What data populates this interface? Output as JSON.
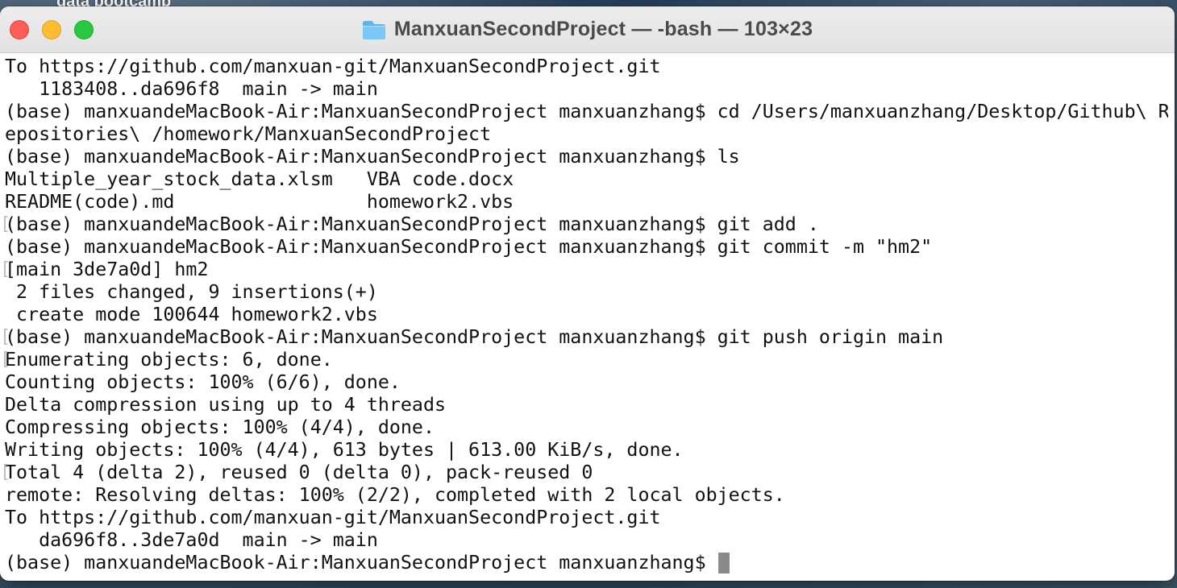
{
  "desktop": {
    "folder_label": "data bootcamp"
  },
  "window": {
    "title": "ManxuanSecondProject — -bash — 103×23",
    "title_icon": "folder-icon"
  },
  "terminal": {
    "lines": [
      {
        "text": "To https://github.com/manxuan-git/ManxuanSecondProject.git",
        "marked": false
      },
      {
        "text": "   1183408..da696f8  main -> main",
        "marked": false
      },
      {
        "text": "(base) manxuandeMacBook-Air:ManxuanSecondProject manxuanzhang$ cd /Users/manxuanzhang/Desktop/Github\\ R",
        "marked": false
      },
      {
        "text": "epositories\\ /homework/ManxuanSecondProject",
        "marked": false
      },
      {
        "text": "(base) manxuandeMacBook-Air:ManxuanSecondProject manxuanzhang$ ls",
        "marked": false
      },
      {
        "text": "Multiple_year_stock_data.xlsm   VBA code.docx",
        "marked": false
      },
      {
        "text": "README(code).md                 homework2.vbs",
        "marked": false
      },
      {
        "text": "(base) manxuandeMacBook-Air:ManxuanSecondProject manxuanzhang$ git add .",
        "marked": true
      },
      {
        "text": "(base) manxuandeMacBook-Air:ManxuanSecondProject manxuanzhang$ git commit -m \"hm2\"",
        "marked": false
      },
      {
        "text": "[main 3de7a0d] hm2",
        "marked": true
      },
      {
        "text": " 2 files changed, 9 insertions(+)",
        "marked": false
      },
      {
        "text": " create mode 100644 homework2.vbs",
        "marked": false
      },
      {
        "text": "(base) manxuandeMacBook-Air:ManxuanSecondProject manxuanzhang$ git push origin main",
        "marked": true
      },
      {
        "text": "Enumerating objects: 6, done.",
        "marked": true
      },
      {
        "text": "Counting objects: 100% (6/6), done.",
        "marked": false
      },
      {
        "text": "Delta compression using up to 4 threads",
        "marked": false
      },
      {
        "text": "Compressing objects: 100% (4/4), done.",
        "marked": false
      },
      {
        "text": "Writing objects: 100% (4/4), 613 bytes | 613.00 KiB/s, done.",
        "marked": false
      },
      {
        "text": "Total 4 (delta 2), reused 0 (delta 0), pack-reused 0",
        "marked": true
      },
      {
        "text": "remote: Resolving deltas: 100% (2/2), completed with 2 local objects.",
        "marked": false
      },
      {
        "text": "To https://github.com/manxuan-git/ManxuanSecondProject.git",
        "marked": false
      },
      {
        "text": "   da696f8..3de7a0d  main -> main",
        "marked": false
      }
    ],
    "prompt": "(base) manxuandeMacBook-Air:ManxuanSecondProject manxuanzhang$ ",
    "colors": {
      "background": "#ffffff",
      "text": "#111111",
      "cursor": "#8a8a8a",
      "close": "#fe5f57",
      "minimize": "#febc2e",
      "zoom": "#28c840"
    }
  }
}
